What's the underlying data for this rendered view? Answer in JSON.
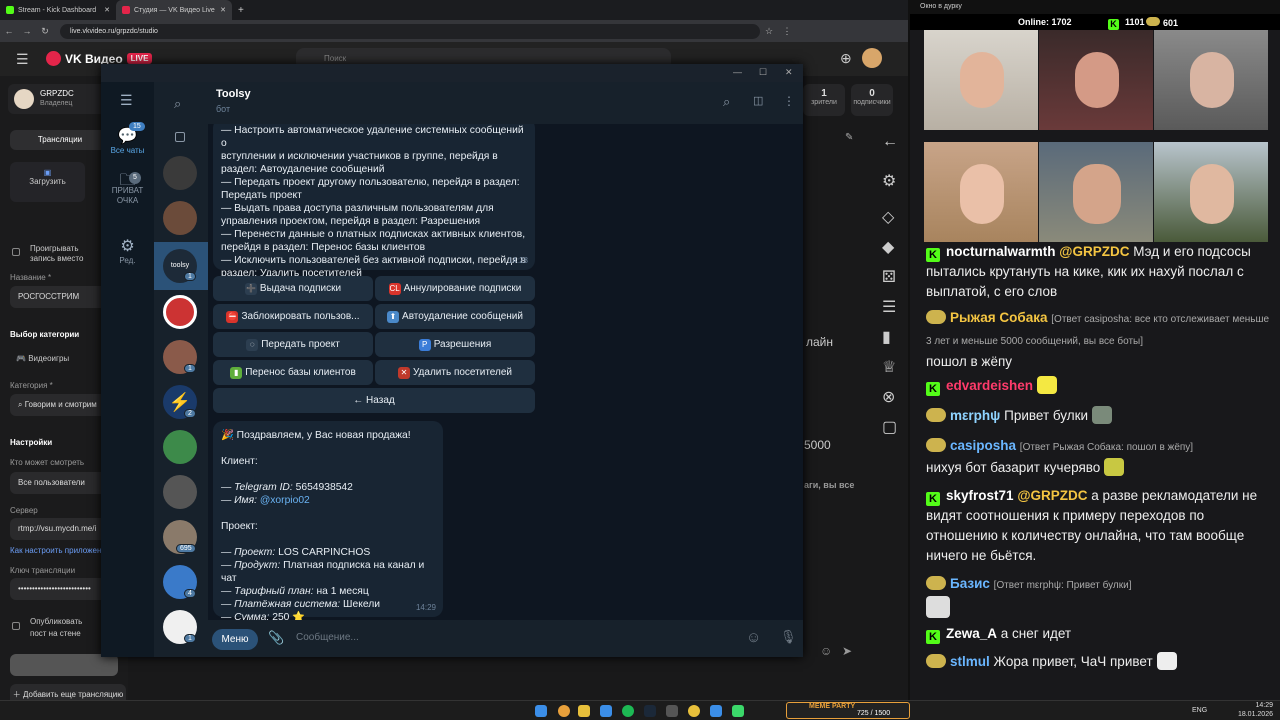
{
  "browser": {
    "tabs": [
      {
        "label": "Stream - Kick Dashboard",
        "color": "#53fc18"
      },
      {
        "label": "Студия — VK Видео Live",
        "color": "#e4254a"
      }
    ],
    "url": "live.vkvideo.ru/grpzdc/studio"
  },
  "vk": {
    "brand": "VK Видео",
    "live_badge": "LIVE",
    "search_placeholder": "Поиск",
    "channel_name": "GRPZDC",
    "channel_role": "Владелец",
    "tab_broadcasts": "Трансляции",
    "upload_label": "Загрузить",
    "cover_checkbox_label": "Проигрывать запись вместо обложки",
    "name_label": "Название *",
    "name_value": "РОСГОССТРИМ",
    "category_choice_label": "Выбор категории",
    "category_games": "Видеоигры",
    "category_label": "Категория *",
    "category_value": "Говорим и смотрим",
    "settings_label": "Настройки",
    "who_can_watch_label": "Кто может смотреть",
    "who_can_watch_value": "Все пользователи",
    "server_label": "Сервер",
    "server_value": "rtmp://vsu.mycdn.me/i",
    "how_to_setup_link": "Как настроить приложение",
    "stream_key_label": "Ключ трансляции",
    "stream_key_value": "••••••••••••••••••••••••••",
    "publish_checkbox_label": "Опубликовать пост на стене сообщества",
    "add_broadcast_button": "Добавить еще трансляцию",
    "stats": [
      {
        "value": "1",
        "label": "зрители"
      },
      {
        "value": "0",
        "label": "подписчики"
      }
    ],
    "bg_text_1": "лайн",
    "bg_text_2": "5000",
    "bg_text_3": "аги, вы все"
  },
  "telegram": {
    "rail": {
      "all_chats": "Все чаты",
      "all_chats_badge": "15",
      "private_label": "ПРИВАТ ОЧКА",
      "private_badge": "5",
      "edit_label": "Ред."
    },
    "chat_list_badges": [
      "1",
      "1",
      "2",
      "695",
      "4",
      "1"
    ],
    "chat_title": "Toolsy",
    "chat_subtitle": "бот",
    "message1": {
      "lines": [
        "— Настроить автоматическое удаление системных сообщений о",
        "вступлении и исключении участников в группе, перейдя в",
        "раздел: Автоудаление сообщений",
        "— Передать проект другому пользователю, перейдя в раздел:",
        "Передать проект",
        "— Выдать права доступа различным пользователям для",
        "управления проектом, перейдя в раздел: Разрешения",
        "— Перенести данные о платных подписках активных клиентов,",
        "перейдя в раздел: Перенос базы клиентов",
        "— Исключить пользователей без активной подписки, перейдя в",
        "раздел: Удалить посетителей"
      ],
      "time": "14:28"
    },
    "keyboard": [
      {
        "label": "Выдача подписки",
        "icon": "plus-icon",
        "glyph": "➕",
        "color": "#2c3e50"
      },
      {
        "label": "Аннулирование подписки",
        "icon": "cl-icon",
        "glyph": "CL",
        "color": "#d9342b"
      },
      {
        "label": "Заблокировать пользов...",
        "icon": "no-entry-icon",
        "glyph": "⛔",
        "color": "#d9342b"
      },
      {
        "label": "Автоудаление сообщений",
        "icon": "arrow-up-icon",
        "glyph": "⬆",
        "color": "#4a89c9"
      },
      {
        "label": "Передать проект",
        "icon": "circle-icon",
        "glyph": "◌",
        "color": "#2c3e50"
      },
      {
        "label": "Разрешения",
        "icon": "p-icon",
        "glyph": "P",
        "color": "#3b7dd8"
      },
      {
        "label": "Перенос базы клиентов",
        "icon": "book-icon",
        "glyph": "▮",
        "color": "#5fae3b"
      },
      {
        "label": "Удалить посетителей",
        "icon": "no-pedestrians-icon",
        "glyph": "✕",
        "color": "#c0392b"
      }
    ],
    "back_button": "← Назад",
    "message2": {
      "headline": "🎉 Поздравляем, у Вас новая продажа!",
      "client_label": "Клиент:",
      "tg_id_label": "— Telegram ID:",
      "tg_id_value": "5654938542",
      "name_label": "— Имя:",
      "name_value": "@xorpio02",
      "project_label": "Проект:",
      "project_key": "— Проект:",
      "project_value": "LOS CARPINCHOS",
      "product_key": "— Продукт:",
      "product_value": "Платная подписка на канал и чат",
      "plan_key": "— Тарифный план:",
      "plan_value": "на 1 месяц",
      "payment_key": "— Платёжная система:",
      "payment_value": "Шекели",
      "sum_key": "— Сумма:",
      "sum_value": "250 ⭐",
      "time": "14:29"
    },
    "menu_button": "Меню",
    "input_placeholder": "Сообщение..."
  },
  "stream_panel": {
    "window_title": "Окно в дурку",
    "online_label": "Online:",
    "online_value": "1702",
    "kick_count": "1101",
    "other_count": "601"
  },
  "chat": [
    {
      "platform": "kick",
      "user": "nocturnalwarmth",
      "user_color": "#ffffff",
      "mention": "@GRPZDC",
      "text": "Мэд и его подсосы пытались крутануть на кике, кик их нахуй послал с выплатой, с его слов"
    },
    {
      "platform": "vk",
      "user": "Рыжая Собака",
      "user_color": "#f4c542",
      "reply": "[Ответ casiposha: все кто отслеживает меньше 3 лет и меньше 5000 сообщений, вы все боты]",
      "text": "пошол в жёпу"
    },
    {
      "platform": "kick",
      "user": "edvardeishen",
      "user_color": "#ff3b6b",
      "text": ""
    },
    {
      "platform": "vk",
      "user": "mεrphψ",
      "user_color": "#8fd3ff",
      "text": "Привет булки"
    },
    {
      "platform": "vk",
      "user": "casiposha",
      "user_color": "#6ab6ff",
      "reply": "[Ответ Рыжая Собака: пошол в жёпу]",
      "text": "нихуя бот базарит кучеряво"
    },
    {
      "platform": "kick",
      "user": "skyfrost71",
      "user_color": "#ffffff",
      "mention": "@GRPZDC",
      "text": "а разве рекламодатели не видят соотношения к примеру переходов по отношению к количеству онлайна, что там вообще ничего не бьётся."
    },
    {
      "platform": "vk",
      "user": "Базис",
      "user_color": "#6ab6ff",
      "reply": "[Ответ mεrphψ: Привет булки]",
      "text": ""
    },
    {
      "platform": "kick",
      "user": "Zewa_A",
      "user_color": "#ffffff",
      "text": "а снег идет"
    },
    {
      "platform": "vk",
      "user": "stlmul",
      "user_color": "#6ab6ff",
      "text": "Жора привет, ЧаЧ привет"
    }
  ],
  "taskbar": {
    "widget_label": "MEME PARTY",
    "widget_counter": "725 / 1500",
    "lang": "ENG",
    "time": "14:29",
    "date": "18.01.2026"
  }
}
